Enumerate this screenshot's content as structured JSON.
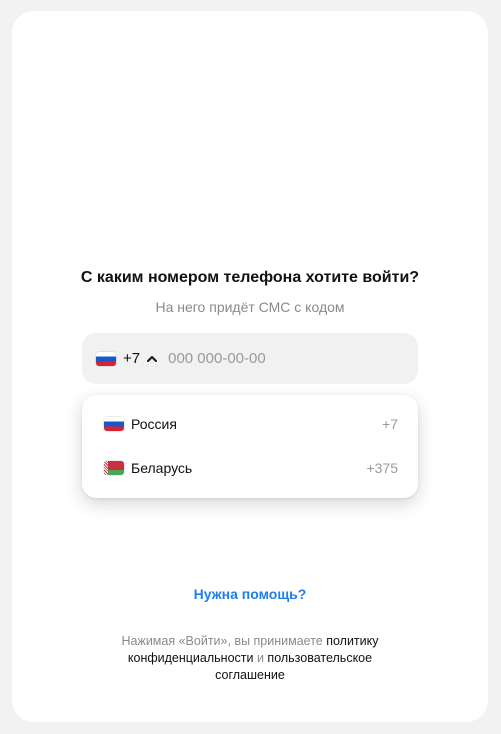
{
  "login": {
    "title": "С каким номером телефона хотите войти?",
    "subtitle": "На него придёт СМС с кодом"
  },
  "phone": {
    "selected_code": "+7",
    "placeholder": "000 000-00-00",
    "selected_flag_icon": "flag-russia-icon",
    "chevron_icon": "chevron-up-icon"
  },
  "countries": [
    {
      "name": "Россия",
      "code": "+7",
      "flag_icon": "flag-russia-icon"
    },
    {
      "name": "Беларусь",
      "code": "+375",
      "flag_icon": "flag-belarus-icon"
    }
  ],
  "help": {
    "label": "Нужна помощь?"
  },
  "legal": {
    "prefix": "Нажимая «Войти», вы принимаете ",
    "privacy_link": "политику конфиденциальности",
    "conjunction": " и ",
    "agreement_link": "пользовательское соглашение"
  },
  "colors": {
    "background": "#f2f2f2",
    "card": "#ffffff",
    "field": "#f1f1f1",
    "link": "#1f7fe6",
    "muted": "#8a8a8a"
  }
}
